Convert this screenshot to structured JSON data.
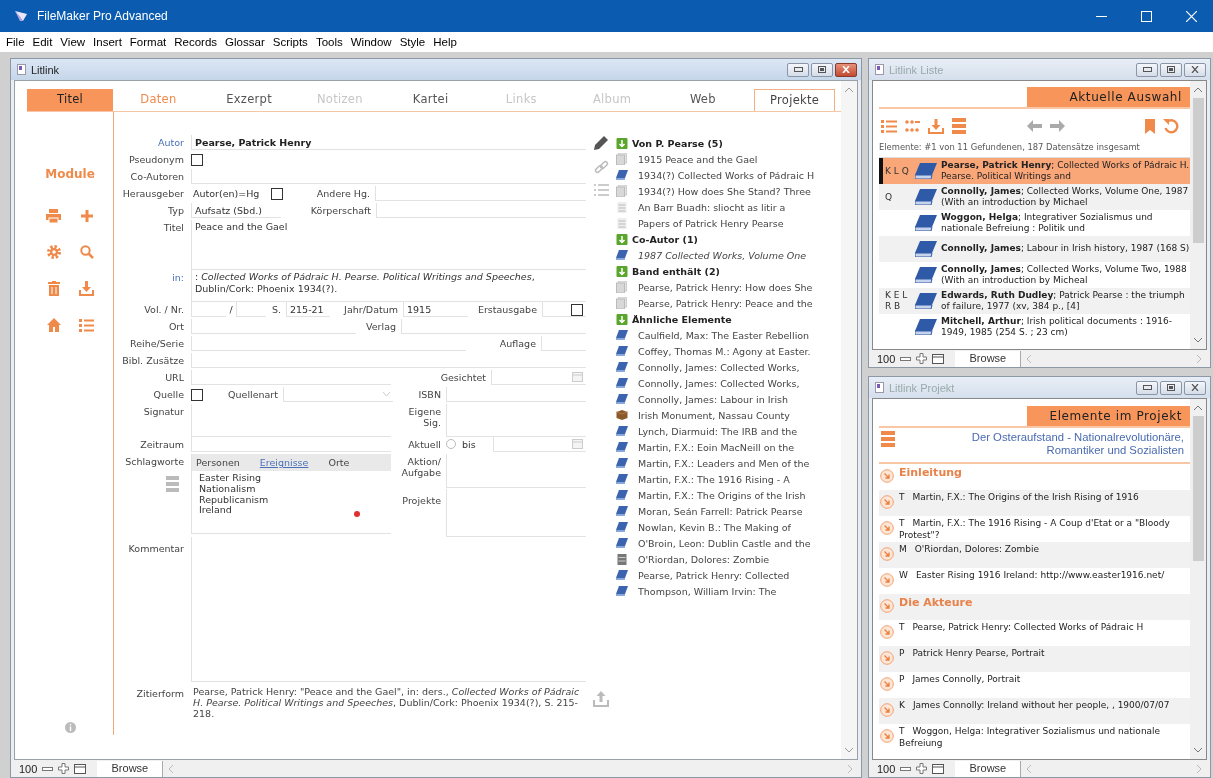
{
  "app": {
    "title": "FileMaker Pro Advanced",
    "menu": [
      "File",
      "Edit",
      "View",
      "Insert",
      "Format",
      "Records",
      "Glossar",
      "Scripts",
      "Tools",
      "Window",
      "Style",
      "Help"
    ]
  },
  "main_window": {
    "title": "Litlink",
    "tabs": [
      {
        "label": "Titel",
        "selected": true,
        "disabled": false,
        "kind": "plain"
      },
      {
        "label": "Daten",
        "selected": false,
        "disabled": false,
        "kind": "accent"
      },
      {
        "label": "Exzerpt",
        "selected": false,
        "disabled": false,
        "kind": "plain"
      },
      {
        "label": "Notizen",
        "selected": false,
        "disabled": true,
        "kind": "plain"
      },
      {
        "label": "Kartei",
        "selected": false,
        "disabled": false,
        "kind": "plain"
      },
      {
        "label": "Links",
        "selected": false,
        "disabled": true,
        "kind": "plain"
      },
      {
        "label": "Album",
        "selected": false,
        "disabled": true,
        "kind": "plain"
      },
      {
        "label": "Web",
        "selected": false,
        "disabled": false,
        "kind": "plain"
      },
      {
        "label": "Projekte",
        "selected": false,
        "disabled": false,
        "kind": "outlined"
      }
    ],
    "sidebar": {
      "label": "Module"
    },
    "form": {
      "autor": {
        "label": "Autor",
        "link": true,
        "value": "Pearse, Patrick Henry"
      },
      "pseudonym": {
        "label": "Pseudonym",
        "checked": false
      },
      "co_autoren": {
        "label": "Co-Autoren"
      },
      "herausgeber": {
        "label": "Herausgeber",
        "option": "Autor(en)=Hg",
        "checked": false
      },
      "andere_hg": {
        "label": "Andere Hg."
      },
      "typ": {
        "label": "Typ",
        "value": "Aufsatz (Sbd.)"
      },
      "koerperschaft": {
        "label": "Körperschaft"
      },
      "titel": {
        "label": "Titel",
        "value": "Peace and the Gael"
      },
      "in": {
        "label": "in:",
        "link": true,
        "value": ": *Collected Works of Pádraic H. Pearse. Political Writings and Speeches*, Dublin/Cork: Phoenix 1934(?)."
      },
      "vol_nr": {
        "label": "Vol. / Nr.",
        "separator": "/"
      },
      "seiten": {
        "label": "S.",
        "value": "215-21"
      },
      "jahr": {
        "label": "Jahr/Datum",
        "value": "1915"
      },
      "erstausgabe": {
        "label": "Erstausgabe",
        "checked": false
      },
      "ort": {
        "label": "Ort"
      },
      "verlag": {
        "label": "Verlag"
      },
      "reihe": {
        "label": "Reihe/Serie"
      },
      "auflage": {
        "label": "Auflage"
      },
      "bibl": {
        "label": "Bibl. Zusätze"
      },
      "url": {
        "label": "URL"
      },
      "gesichtet": {
        "label": "Gesichtet"
      },
      "quelle": {
        "label": "Quelle",
        "checked": false
      },
      "quellenart": {
        "label": "Quellenart"
      },
      "isbn": {
        "label": "ISBN"
      },
      "signatur": {
        "label": "Signatur"
      },
      "eigene_sig": {
        "label": "Eigene Sig."
      },
      "zeitraum": {
        "label": "Zeitraum"
      },
      "aktuell": {
        "label": "Aktuell",
        "selected": false,
        "to_label": "bis"
      },
      "schlagworte": {
        "label": "Schlagworte",
        "tabs": [
          {
            "label": "Personen",
            "selected": false
          },
          {
            "label": "Ereignisse",
            "selected": true
          },
          {
            "label": "Orte",
            "selected": false
          }
        ],
        "items": [
          "Easter Rising",
          "Nationalism",
          "Republicanism",
          "Ireland"
        ]
      },
      "aktion": {
        "label": "Aktion/ Aufgabe"
      },
      "projekte": {
        "label": "Projekte"
      },
      "kommentar": {
        "label": "Kommentar"
      },
      "zitierform": {
        "label": "Zitierform",
        "value": "Pearse, Patrick Henry: \"Peace and the Gael\", in: ders., *Collected Works of Pádraic H. Pearse. Political Writings and Speeches*, Dublin/Cork: Phoenix 1934(?), S. 215-218."
      }
    },
    "related": [
      {
        "title": "Von P. Pearse (5)",
        "items": [
          {
            "text": "1915 Peace and the Gael",
            "kind": "page",
            "italic": false
          },
          {
            "text": "1934(?) Collected Works of Pádraic H",
            "kind": "book",
            "italic": false
          },
          {
            "text": "1934(?) How does She Stand? Three",
            "kind": "page",
            "italic": false
          },
          {
            "text": "An Barr Buadh: sliocht as litir a",
            "kind": "text",
            "italic": false
          },
          {
            "text": "Papers of Patrick Henry Pearse",
            "kind": "text",
            "italic": false
          }
        ]
      },
      {
        "title": "Co-Autor (1)",
        "items": [
          {
            "text": "1987 Collected Works, Volume One",
            "kind": "book",
            "italic": true
          }
        ]
      },
      {
        "title": "Band enthält (2)",
        "items": [
          {
            "text": "Pearse, Patrick Henry: How does She",
            "kind": "page",
            "italic": false
          },
          {
            "text": "Pearse, Patrick Henry: Peace and the",
            "kind": "page",
            "italic": false
          }
        ]
      },
      {
        "title": "Ähnliche Elemente",
        "items": [
          {
            "text": "Caulfield, Max: The Easter Rebellion",
            "kind": "book",
            "italic": false
          },
          {
            "text": "Coffey, Thomas M.: Agony at Easter.",
            "kind": "book",
            "italic": false
          },
          {
            "text": "Connolly, James: Collected Works,",
            "kind": "book",
            "italic": false
          },
          {
            "text": "Connolly, James: Collected Works,",
            "kind": "book",
            "italic": false
          },
          {
            "text": "Connolly, James: Labour in Irish",
            "kind": "book",
            "italic": false
          },
          {
            "text": "Irish Monument, Nassau County",
            "kind": "object",
            "italic": false
          },
          {
            "text": "Lynch, Diarmuid: The IRB and the",
            "kind": "book",
            "italic": false
          },
          {
            "text": "Martin, F.X.: Eoin MacNeill on the",
            "kind": "book",
            "italic": false
          },
          {
            "text": "Martin, F.X.: Leaders and Men of the",
            "kind": "book",
            "italic": false
          },
          {
            "text": "Martin, F.X.: The 1916 Rising - A",
            "kind": "book",
            "italic": false
          },
          {
            "text": "Martin, F.X.: The Origins of the Irish",
            "kind": "book",
            "italic": false
          },
          {
            "text": "Moran, Seán Farrell: Patrick Pearse",
            "kind": "book",
            "italic": false
          },
          {
            "text": "Nowlan, Kevin B.: The Making of",
            "kind": "book",
            "italic": false
          },
          {
            "text": "O'Broin, Leon: Dublin Castle and the",
            "kind": "book",
            "italic": false
          },
          {
            "text": "O'Riordan, Dolores: Zombie",
            "kind": "file",
            "italic": false
          },
          {
            "text": "Pearse, Patrick Henry: Collected",
            "kind": "book",
            "italic": false
          },
          {
            "text": "Thompson, William Irvin: The",
            "kind": "book",
            "italic": false
          }
        ]
      }
    ],
    "status_bar": {
      "zoom": "100",
      "mode": "Browse"
    }
  },
  "list_window": {
    "title": "Litlink Liste",
    "heading": "Aktuelle Auswahl",
    "status": "Elemente: #1 von 11 Gefundenen, 187 Datensätze insgesamt",
    "rows": [
      {
        "flags": "K L Q",
        "text": "**Pearse, Patrick Henry**; Collected Works of Pádraic H. Pearse. Political Writings and",
        "selected": true
      },
      {
        "flags": "Q",
        "text": "**Connolly, James**; Collected Works, Volume One, 1987 (With an introduction by Michael",
        "selected": false
      },
      {
        "text": "**Woggon, Helga**; Integrativer Sozialismus und nationale Befreiung : Politik und",
        "selected": false
      },
      {
        "text": "**Connolly, James**; Labour in Irish history, 1987 (168 S)",
        "selected": false
      },
      {
        "text": "**Connolly, James**; Collected Works, Volume Two, 1988 (With an introduction by Micheal",
        "selected": false
      },
      {
        "flags": "K E L R B",
        "text": "**Edwards, Ruth Dudley**; Patrick Pearse : the triumph of failure, 1977 (xv, 384 p., [4]",
        "selected": false
      },
      {
        "text": "**Mitchell, Arthur**; Irish political documents : 1916-1949, 1985 (254 S. ; 23 cm)",
        "selected": false
      }
    ],
    "status_bar": {
      "zoom": "100",
      "mode": "Browse"
    }
  },
  "project_window": {
    "title": "Litlink Projekt",
    "heading": "Elemente im Projekt",
    "project": "Der Osteraufstand - Nationalrevolutionäre, Romantiker und Sozialisten",
    "entries": [
      {
        "kind": "section",
        "text": "Einleitung"
      },
      {
        "kind": "item",
        "type": "T",
        "text": "Martin, F.X.: The Origins of the Irish Rising of 1916"
      },
      {
        "kind": "item",
        "type": "T",
        "text": "Martin, F.X.: The 1916 Rising - A Coup d'Etat or a \"Bloody Protest\"?"
      },
      {
        "kind": "item",
        "type": "M",
        "text": "O'Riordan, Dolores: Zombie"
      },
      {
        "kind": "item",
        "type": "W",
        "text": "Easter Rising 1916 Ireland: http://www.easter1916.net/"
      },
      {
        "kind": "section",
        "text": "Die Akteure"
      },
      {
        "kind": "item",
        "type": "T",
        "text": "Pearse, Patrick Henry: Collected Works of Pádraic H"
      },
      {
        "kind": "item",
        "type": "P",
        "text": "Patrick Henry Pearse, Portrait"
      },
      {
        "kind": "item",
        "type": "P",
        "text": "James Connolly, Portrait"
      },
      {
        "kind": "item",
        "type": "K",
        "text": "James Connolly: Ireland without her people, , 1900/07/07"
      },
      {
        "kind": "item",
        "type": "T",
        "text": "Woggon, Helga: Integrativer Sozialismus und nationale Befreiung"
      }
    ],
    "status_bar": {
      "zoom": "100",
      "mode": "Browse"
    }
  }
}
